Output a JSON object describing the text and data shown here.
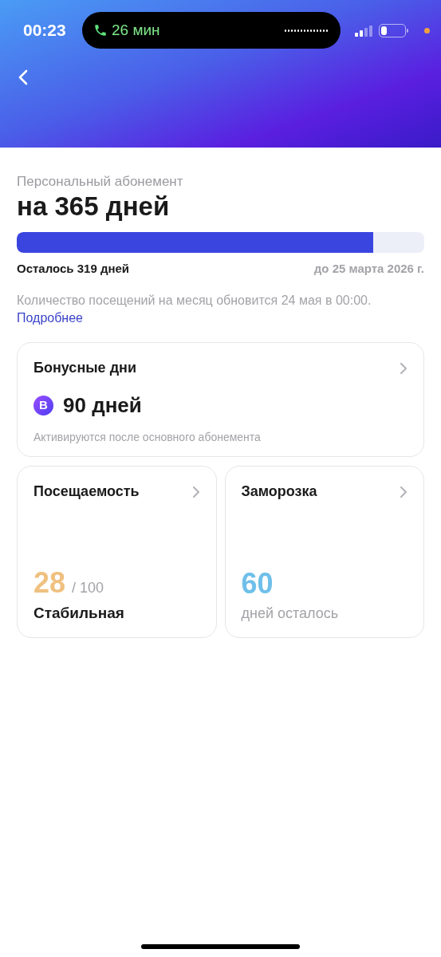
{
  "status_bar": {
    "time": "00:23",
    "call_duration": "26 мин"
  },
  "subscription": {
    "label": "Персональный абонемент",
    "title": "на 365 дней",
    "progress": {
      "level": 0.874
    },
    "remaining": "Осталось 319 дней",
    "until": "до 25 марта 2026 г.",
    "note": "Количество посещений на месяц обновится 24 мая в 00:00.",
    "note_link": "Подробнее"
  },
  "bonus_card": {
    "title": "Бонусные дни",
    "badge": "В",
    "value": "90 дней",
    "caption": "Активируются после основного абонемента"
  },
  "tiles": [
    {
      "kind": "score",
      "title": "Посещаемость",
      "value": "28",
      "color": "#efc07f",
      "suffix": "/ 100",
      "caption": "Стабильная"
    },
    {
      "kind": "count",
      "title": "Заморозка",
      "value": "60",
      "color": "#6fbfea",
      "caption": "дней осталось"
    }
  ]
}
